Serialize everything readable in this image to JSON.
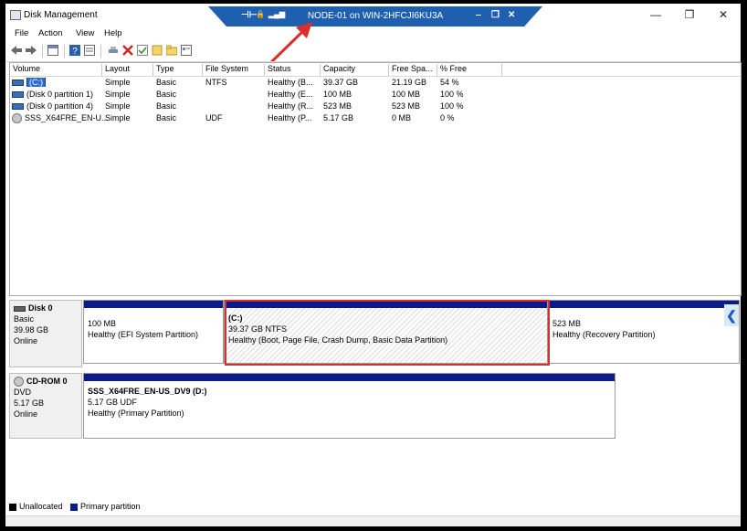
{
  "window": {
    "title": "Disk Management",
    "minimize": "—",
    "maximize": "❐",
    "close": "✕"
  },
  "remote_bar": {
    "title": "NODE-01 on WIN-2HFCJI6KU3A",
    "pin": "⊣⊢",
    "lock": "🔒",
    "signal": "▂▄▆",
    "min": "‒",
    "restore": "❐",
    "close": "✕"
  },
  "menu": [
    "File",
    "Action",
    "View",
    "Help"
  ],
  "colors": {
    "primary_partition": "#0b1a8a",
    "unallocated": "#000000",
    "annotation": "#d9302b",
    "selection": "#2c6cd1"
  },
  "columns": [
    "Volume",
    "Layout",
    "Type",
    "File System",
    "Status",
    "Capacity",
    "Free Spa...",
    "% Free"
  ],
  "volumes": [
    {
      "icon": "volume-icon",
      "volume": "(C:)",
      "layout": "Simple",
      "type": "Basic",
      "fs": "NTFS",
      "status": "Healthy (B...",
      "capacity": "39.37 GB",
      "free": "21.19 GB",
      "pct": "54 %"
    },
    {
      "icon": "volume-icon",
      "volume": "(Disk 0 partition 1)",
      "layout": "Simple",
      "type": "Basic",
      "fs": "",
      "status": "Healthy (E...",
      "capacity": "100 MB",
      "free": "100 MB",
      "pct": "100 %"
    },
    {
      "icon": "volume-icon",
      "volume": "(Disk 0 partition 4)",
      "layout": "Simple",
      "type": "Basic",
      "fs": "",
      "status": "Healthy (R...",
      "capacity": "523 MB",
      "free": "523 MB",
      "pct": "100 %"
    },
    {
      "icon": "cdrom-icon",
      "volume": "SSS_X64FRE_EN-U...",
      "layout": "Simple",
      "type": "Basic",
      "fs": "UDF",
      "status": "Healthy (P...",
      "capacity": "5.17 GB",
      "free": "0 MB",
      "pct": "0 %"
    }
  ],
  "disks": [
    {
      "name": "Disk 0",
      "kind": "Basic",
      "size": "39.98 GB",
      "state": "Online",
      "partitions": [
        {
          "title": "",
          "size": "100 MB",
          "status": "Healthy (EFI System Partition)"
        },
        {
          "title": "(C:)",
          "size": "39.37 GB NTFS",
          "status": "Healthy (Boot, Page File, Crash Dump, Basic Data Partition)"
        },
        {
          "title": "",
          "size": "523 MB",
          "status": "Healthy (Recovery Partition)"
        }
      ]
    },
    {
      "name": "CD-ROM 0",
      "kind": "DVD",
      "size": "5.17 GB",
      "state": "Online",
      "partitions": [
        {
          "title": "SSS_X64FRE_EN-US_DV9  (D:)",
          "size": "5.17 GB UDF",
          "status": "Healthy (Primary Partition)"
        }
      ]
    }
  ],
  "legend": {
    "unallocated": "Unallocated",
    "primary": "Primary partition"
  }
}
